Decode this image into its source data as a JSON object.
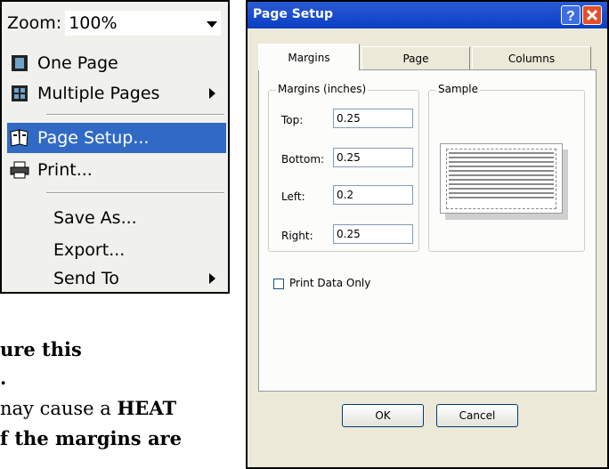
{
  "menu": {
    "zoom_label": "Zoom:",
    "zoom_value": "100%",
    "items": [
      {
        "label": "One Page",
        "icon": "one-page-icon"
      },
      {
        "label": "Multiple Pages",
        "icon": "multiple-pages-icon"
      },
      {
        "label": "Page Setup...",
        "icon": "page-setup-icon"
      },
      {
        "label": "Print...",
        "icon": "print-icon"
      },
      {
        "label": "Save As..."
      },
      {
        "label": "Export..."
      },
      {
        "label": "Send To"
      }
    ],
    "selected_color": "#316ac5"
  },
  "caption": {
    "line1": "ure this",
    "line2": ".",
    "line3_pre": "nay cause a ",
    "line3_bold": "HEAT",
    "line4": "f the margins are"
  },
  "dialog": {
    "title": "Page Setup",
    "tabs": [
      "Margins",
      "Page",
      "Columns"
    ],
    "active_tab": "Margins",
    "margins_group": "Margins (inches)",
    "sample_group": "Sample",
    "fields": [
      {
        "label": "Top:",
        "value": "0.25"
      },
      {
        "label": "Bottom:",
        "value": "0.25"
      },
      {
        "label": "Left:",
        "value": "0.2"
      },
      {
        "label": "Right:",
        "value": "0.25"
      }
    ],
    "print_data_only": "Print Data Only",
    "ok_label": "OK",
    "cancel_label": "Cancel",
    "titlebar_color": "#0a46d8"
  }
}
